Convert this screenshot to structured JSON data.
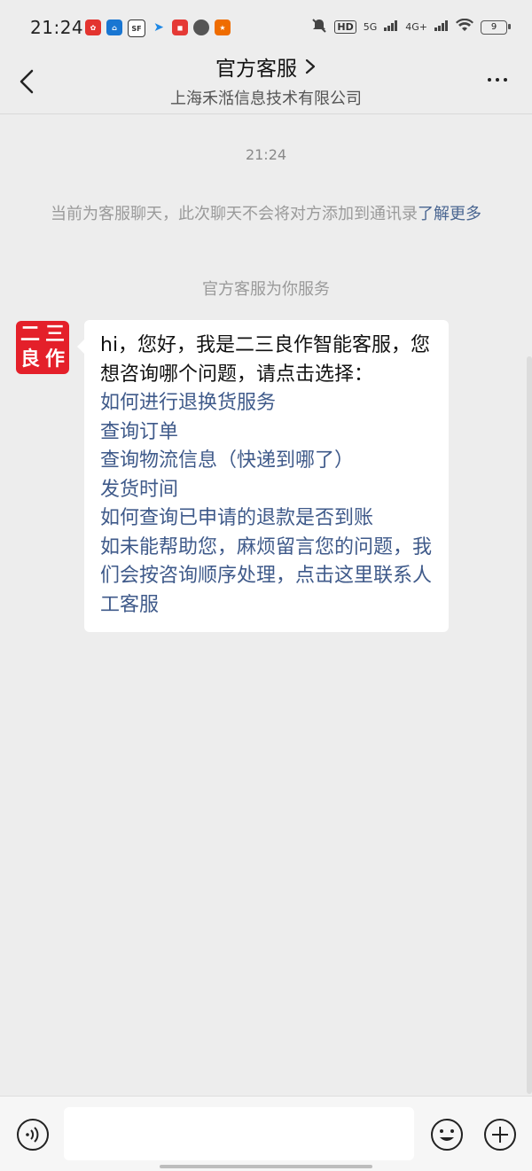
{
  "status_bar": {
    "time": "21:24",
    "notification_icons": [
      "app-red-icon",
      "app-blue-icon",
      "app-sf-icon",
      "telegram-icon",
      "app-red2-icon",
      "chat-bubble-icon",
      "app-orange-icon"
    ],
    "network": [
      "HD",
      "5G",
      "4G+"
    ],
    "battery": "9"
  },
  "header": {
    "title": "官方客服",
    "subtitle": "上海禾湉信息技术有限公司"
  },
  "chat": {
    "timestamp": "21:24",
    "notice_text": "当前为客服聊天，此次聊天不会将对方添加到通讯录",
    "notice_link": "了解更多",
    "service_text": "官方客服为你服务",
    "avatar_chars": [
      "二",
      "三",
      "良",
      "作"
    ],
    "message_intro": "hi，您好，我是二三良作智能客服，您想咨询哪个问题，请点击选择：",
    "options": [
      "如何进行退换货服务",
      "查询订单",
      "查询物流信息（快递到哪了）",
      "发货时间",
      "如何查询已申请的退款是否到账",
      "如未能帮助您，麻烦留言您的问题，我们会按咨询顺序处理，点击这里联系人工客服"
    ]
  },
  "input_bar": {
    "value": "",
    "icons": [
      "voice-icon",
      "emoji-icon",
      "plus-icon"
    ]
  },
  "colors": {
    "background": "#ededed",
    "link": "#3f5a8a",
    "avatar": "#e4202a"
  }
}
